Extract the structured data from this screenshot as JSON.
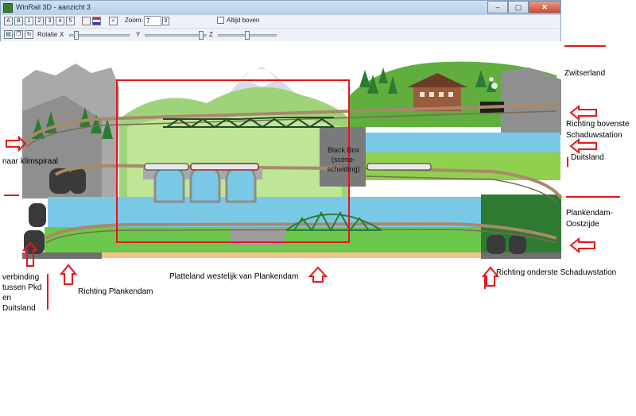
{
  "window": {
    "title": "WinRail 3D - aanzicht 3",
    "min_label": "–",
    "max_label": "▢",
    "close_label": "✕"
  },
  "toolbar": {
    "buttons": [
      "A",
      "B",
      "1",
      "2",
      "3",
      "4",
      "5"
    ],
    "zoom_label": "Zoom:",
    "zoom_value": "7",
    "always_on_top_label": "Altijd boven",
    "rotation_label": "Rotatie",
    "axis_x": "X",
    "axis_y": "Y",
    "axis_z": "Z",
    "slider_x_level": 0.08,
    "slider_y_level": 0.95,
    "slider_z_level": 0.5
  },
  "annotations": {
    "zwitserland": "Zwitserland",
    "richting_bovenste_1": "Richting bovenste",
    "richting_bovenste_2": "Schaduwstation",
    "duitsland": "Duitsland",
    "plankendam_oost_1": "Plankendam-",
    "plankendam_oost_2": "Oostzijde",
    "richting_onderste": "Richting onderste Schaduwstation",
    "naar_klimspiraal": "naar klimspiraal",
    "verbinding_1": "verbinding",
    "verbinding_2": "tussen Pkd",
    "verbinding_3": "en",
    "verbinding_4": "Duitsland",
    "richting_plankendam": "Richting Plankendam",
    "platteland": "Platteland westelijk van Plankendam",
    "blackbox_1": "Black Box",
    "blackbox_2": "(scène-",
    "blackbox_3": "scheiding)"
  },
  "colors": {
    "annotation_red": "#e8141b",
    "sky": "#ffffff",
    "water": "#79c9e6",
    "grass": "#6cc84a",
    "track": "#a8896a"
  }
}
